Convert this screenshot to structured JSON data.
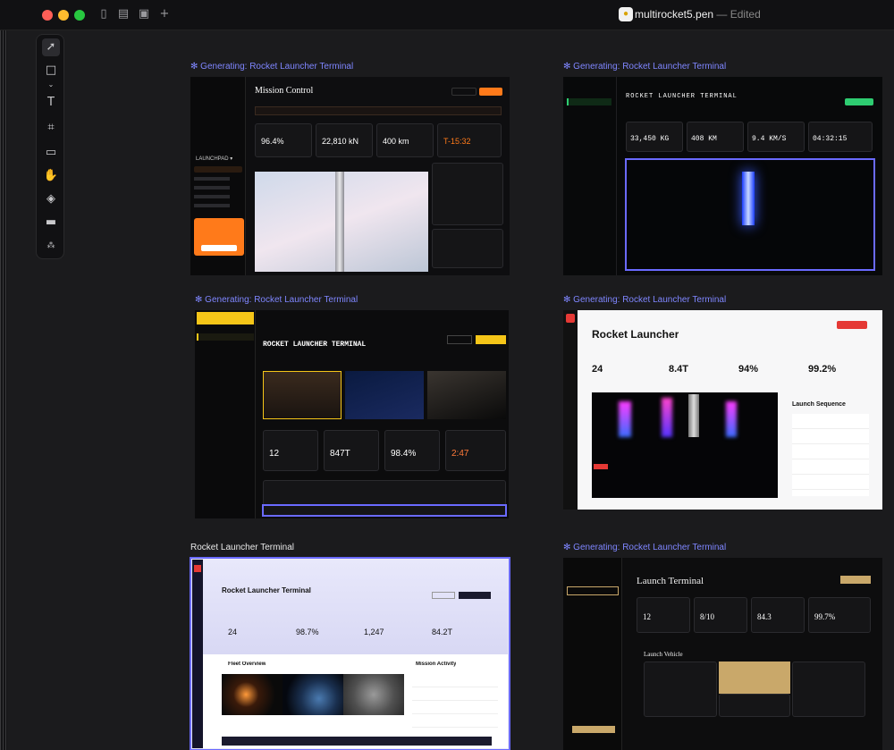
{
  "window": {
    "title": "multirocket5.pen",
    "status": "— Edited"
  },
  "frames": {
    "f1": {
      "label": "Generating: Rocket Launcher Terminal",
      "heading": "Mission Control",
      "brand": "LAUNCHPAD ▾",
      "stats": [
        "96.4%",
        "22,810 kN",
        "400 km",
        "T-15:32"
      ]
    },
    "f2": {
      "label": "Generating: Rocket Launcher Terminal",
      "heading": "ROCKET LAUNCHER TERMINAL",
      "stats": [
        "33,450 KG",
        "408 KM",
        "9.4 KM/S",
        "04:32:15"
      ]
    },
    "f3": {
      "label": "Generating: Rocket Launcher Terminal",
      "heading": "ROCKET LAUNCHER TERMINAL",
      "stats": [
        "12",
        "847T",
        "98.4%",
        "2:47"
      ]
    },
    "f4": {
      "label": "Generating: Rocket Launcher Terminal",
      "heading": "Rocket Launcher",
      "panel": "Launch Sequence",
      "stats": [
        "24",
        "8.4T",
        "94%",
        "99.2%"
      ]
    },
    "f5": {
      "label": "Rocket Launcher Terminal",
      "heading": "Rocket Launcher Terminal",
      "section": "Fleet Overview",
      "activity": "Mission Activity",
      "stats": [
        "24",
        "98.7%",
        "1,247",
        "84.2T"
      ]
    },
    "f6": {
      "label": "Generating: Rocket Launcher Terminal",
      "heading": "Launch Terminal",
      "section": "Launch Vehicle",
      "stats": [
        "12",
        "8/10",
        "84.3",
        "99.7%"
      ]
    }
  },
  "colors": {
    "accent": "#7f86ff",
    "orange": "#ff7a1a",
    "yellow": "#f5c518",
    "red": "#e53935",
    "gold": "#c9a86a"
  }
}
